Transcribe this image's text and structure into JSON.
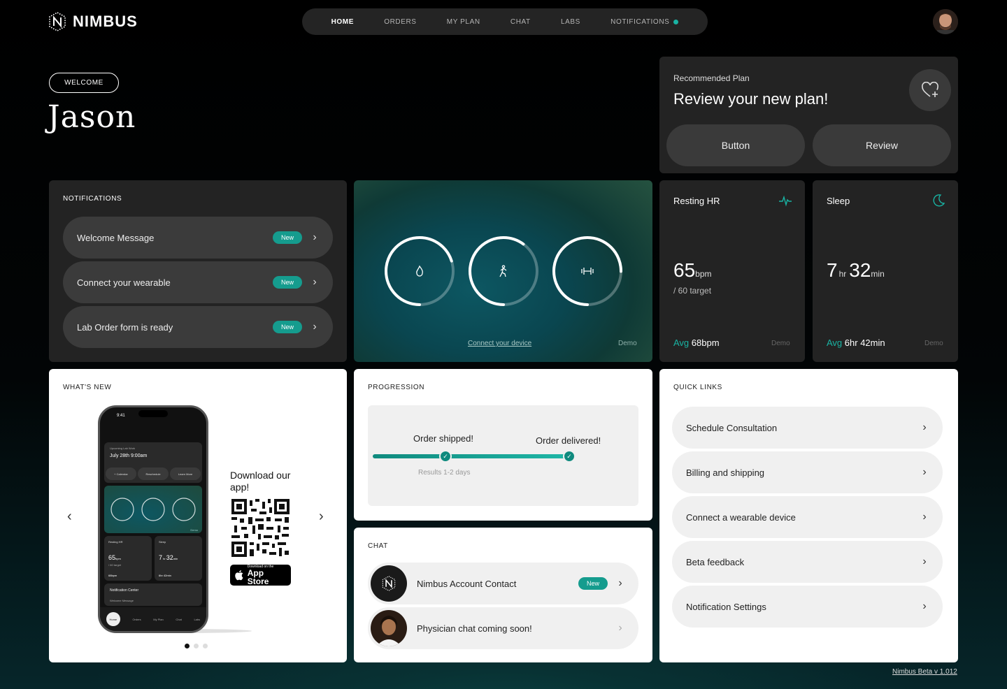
{
  "brand": {
    "name": "NIMBUS"
  },
  "nav": {
    "items": [
      {
        "label": "HOME",
        "active": true
      },
      {
        "label": "ORDERS"
      },
      {
        "label": "MY PLAN"
      },
      {
        "label": "CHAT"
      },
      {
        "label": "LABS"
      },
      {
        "label": "NOTIFICATIONS",
        "dot": true
      }
    ]
  },
  "welcome": {
    "pill": "WELCOME",
    "name": "Jason"
  },
  "plan": {
    "kicker": "Recommended Plan",
    "title": "Review your new plan!",
    "button1": "Button",
    "button2": "Review"
  },
  "notifications": {
    "title": "NOTIFICATIONS",
    "items": [
      {
        "label": "Welcome Message",
        "badge": "New"
      },
      {
        "label": "Connect your wearable",
        "badge": "New"
      },
      {
        "label": "Lab Order form is ready",
        "badge": "New"
      }
    ]
  },
  "rings": {
    "connect": "Connect your device",
    "demo": "Demo",
    "items": [
      {
        "icon": "flame-icon",
        "progress": 0.7
      },
      {
        "icon": "walk-icon",
        "progress": 0.6
      },
      {
        "icon": "dumbbell-icon",
        "progress": 0.75
      }
    ]
  },
  "resting_hr": {
    "title": "Resting HR",
    "value": "65",
    "unit": "bpm",
    "target": "/ 60 target",
    "avg_label": "Avg",
    "avg_value": "68bpm",
    "demo": "Demo"
  },
  "sleep": {
    "title": "Sleep",
    "hr": "7",
    "hr_unit": "hr",
    "min": "32",
    "min_unit": "min",
    "avg_label": "Avg",
    "avg_value": "6hr 42min",
    "demo": "Demo"
  },
  "whats_new": {
    "title": "WHAT'S NEW",
    "download": "Download our app!",
    "store_small": "Download on the",
    "store_big": "App Store",
    "phone": {
      "time": "9:41",
      "upcoming": "Upcoming Lab Work",
      "date": "July 28th 9:00am",
      "btn1": "+ Calendar",
      "btn2": "Reschedule",
      "btn3": "Learn More",
      "demo": "Demo",
      "hr_title": "Resting HR",
      "hr_value": "65",
      "hr_unit": "bpm",
      "hr_target": "/ 60 target",
      "hr_avg": "68bpm",
      "sleep_title": "Sleep",
      "sleep_hr": "7",
      "sleep_min": "32",
      "sleep_avg": "6hr 42min",
      "notif_center": "Notification Center",
      "welcome_msg": "Welcome Message",
      "tabs": [
        "Home",
        "Orders",
        "My Plan",
        "Chat",
        "Labs"
      ]
    }
  },
  "progression": {
    "title": "PROGRESSION",
    "step1": "Order shipped!",
    "step2": "Order delivered!",
    "results": "Results 1-2 days",
    "progress": 0.82
  },
  "chat": {
    "title": "CHAT",
    "items": [
      {
        "label": "Nimbus Account Contact",
        "badge": "New"
      },
      {
        "label": "Physician chat coming soon!"
      }
    ]
  },
  "quick_links": {
    "title": "QUICK LINKS",
    "items": [
      {
        "label": "Schedule Consultation"
      },
      {
        "label": "Billing and shipping"
      },
      {
        "label": "Connect a wearable device"
      },
      {
        "label": "Beta feedback"
      },
      {
        "label": "Notification Settings"
      }
    ]
  },
  "version": "Nimbus Beta v 1.012",
  "colors": {
    "accent": "#159c8e",
    "dark_card": "#232323"
  }
}
